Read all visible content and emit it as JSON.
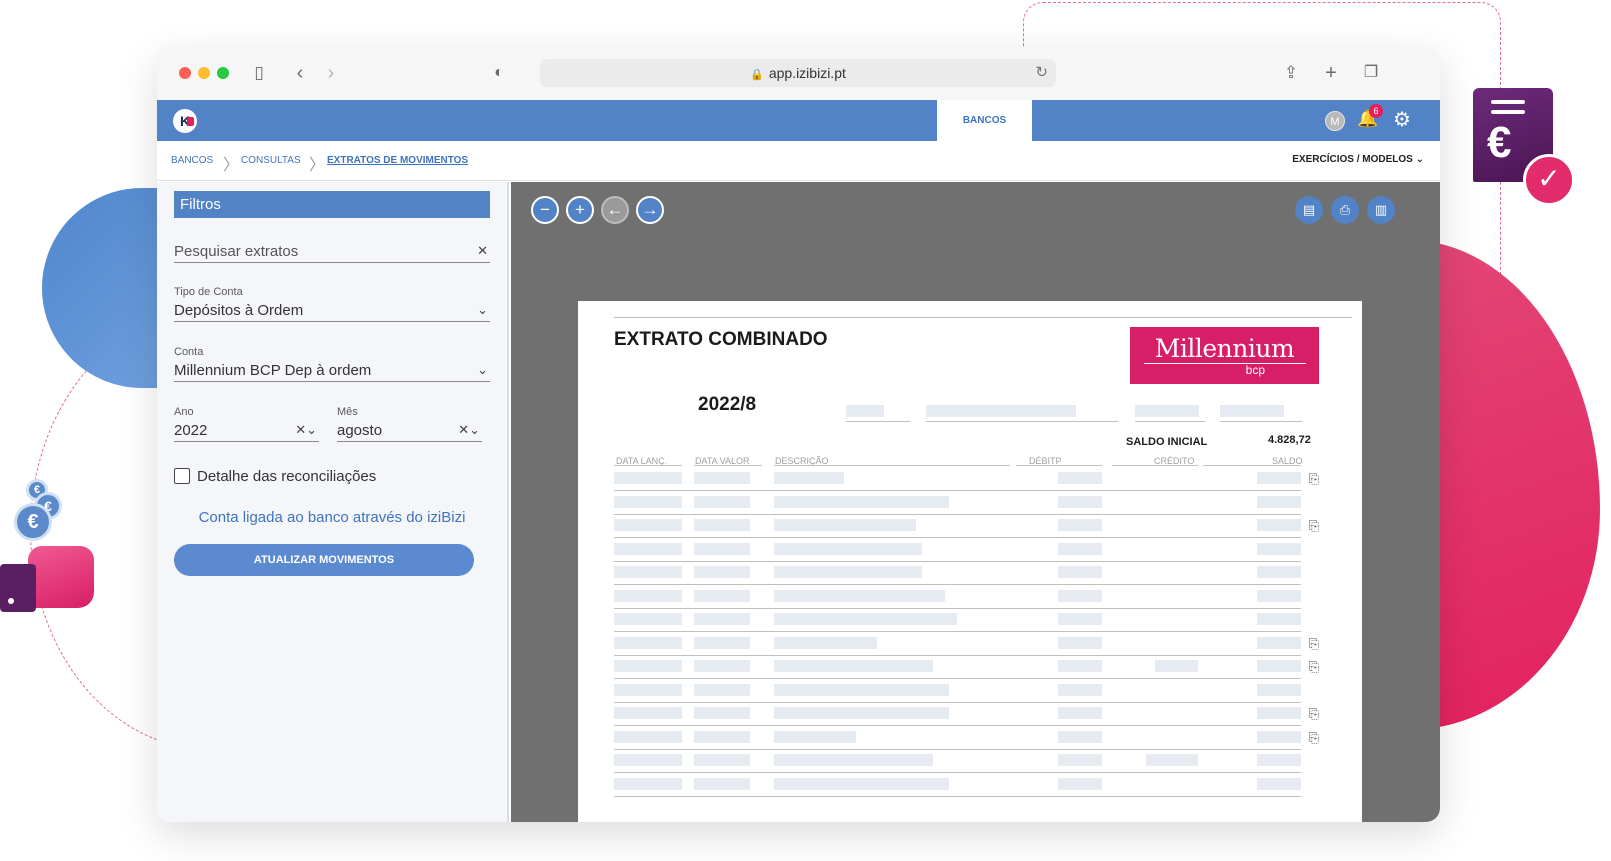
{
  "browser": {
    "url": "app.izibizi.pt"
  },
  "appbar": {
    "logo_letter": "K",
    "active_tab": "BANCOS",
    "avatar_initial": "M",
    "notifications_count": "6"
  },
  "breadcrumb": {
    "items": [
      "BANCOS",
      "CONSULTAS",
      "EXTRATOS DE MOVIMENTOS"
    ],
    "right_menu": "EXERCÍCIOS / MODELOS"
  },
  "filters": {
    "title": "Filtros",
    "search_placeholder": "Pesquisar extratos",
    "tipo_conta": {
      "label": "Tipo de Conta",
      "value": "Depósitos à Ordem"
    },
    "conta": {
      "label": "Conta",
      "value": "Millennium BCP Dep à ordem"
    },
    "ano": {
      "label": "Ano",
      "value": "2022"
    },
    "mes": {
      "label": "Mês",
      "value": "agosto"
    },
    "detalhe_checkbox": "Detalhe das reconciliações",
    "link_text": "Conta ligada ao banco através do iziBizi",
    "update_button": "ATUALIZAR MOVIMENTOS"
  },
  "statement": {
    "title": "EXTRATO COMBINADO",
    "period": "2022/8",
    "bank_logo_name": "Millennium",
    "bank_logo_sub": "bcp",
    "saldo_inicial_label": "SALDO INICIAL",
    "saldo_inicial_value": "4.828,72",
    "columns": [
      "DATA LANÇ.",
      "DATA VALOR",
      "DESCRIÇÃO",
      "DÉBITP",
      "CRÉDITO",
      "SALDO"
    ],
    "rows": [
      {
        "desc": 0.34,
        "debit": true,
        "credit": 0,
        "clip": true
      },
      {
        "desc": 0.85,
        "debit": true,
        "credit": 0,
        "clip": false
      },
      {
        "desc": 0.69,
        "debit": true,
        "credit": 0,
        "clip": true
      },
      {
        "desc": 0.72,
        "debit": true,
        "credit": 0,
        "clip": false
      },
      {
        "desc": 0.72,
        "debit": true,
        "credit": 0,
        "clip": false
      },
      {
        "desc": 0.83,
        "debit": true,
        "credit": 0,
        "clip": false
      },
      {
        "desc": 0.89,
        "debit": true,
        "credit": 0,
        "clip": false
      },
      {
        "desc": 0.5,
        "debit": true,
        "credit": 0,
        "clip": true
      },
      {
        "desc": 0.77,
        "debit": true,
        "credit": 0.48,
        "clip": true
      },
      {
        "desc": 0.85,
        "debit": true,
        "credit": 0,
        "clip": false
      },
      {
        "desc": 0.85,
        "debit": true,
        "credit": 0,
        "clip": true
      },
      {
        "desc": 0.4,
        "debit": true,
        "credit": 0,
        "clip": true
      },
      {
        "desc": 0.77,
        "debit": true,
        "credit": 0.58,
        "clip": false
      },
      {
        "desc": 0.85,
        "debit": true,
        "credit": 0,
        "clip": false
      }
    ]
  },
  "icons": {
    "zoom_out": "minus-circle-icon",
    "zoom_in": "plus-circle-icon",
    "prev": "arrow-left-icon",
    "next": "arrow-right-icon",
    "excel": "excel-export-icon",
    "print": "printer-icon",
    "pdf": "pdf-export-icon",
    "attachment": "paperclip-icon"
  },
  "colors": {
    "brand_blue": "#5183c6",
    "brand_pink": "#d81e66",
    "viewer_bg": "#707070"
  }
}
